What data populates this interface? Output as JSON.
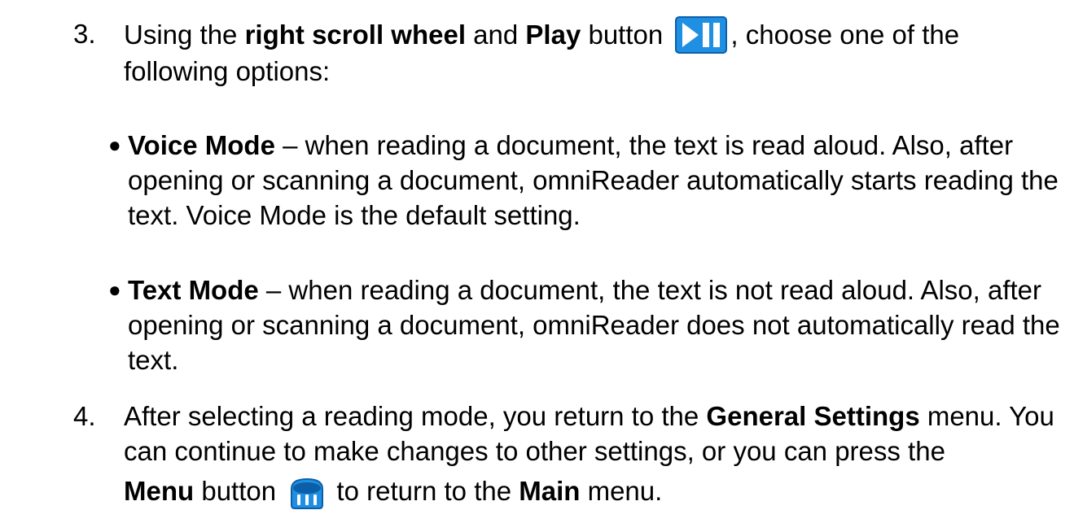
{
  "step3": {
    "number": "3.",
    "t1": "Using the ",
    "b1": "right scroll wheel",
    "t2": " and ",
    "b2": "Play",
    "t3": " button ",
    "t4": ", choose one of the following options:",
    "icon": "play-pause-icon",
    "icon_color": "#1f8fe3"
  },
  "bullets": [
    {
      "title": "Voice Mode",
      "text": " – when reading a document, the text is read aloud. Also, after opening or scanning a document, omniReader automatically starts reading the text. Voice Mode is the default setting."
    },
    {
      "title": "Text Mode",
      "text": " – when reading a document, the text is not read aloud. Also, after opening or scanning a document, omniReader does not automatically read the text."
    }
  ],
  "step4": {
    "number": "4.",
    "t1": "After selecting a reading mode, you return to the ",
    "b1": "General Settings",
    "t2": " menu. You can continue to make changes to other settings, or you can press the",
    "b2": "Menu",
    "t3": " button ",
    "t4": " to return to the ",
    "b3": "Main",
    "t5": " menu.",
    "icon": "menu-button-icon",
    "icon_color": "#1f8fe3"
  }
}
